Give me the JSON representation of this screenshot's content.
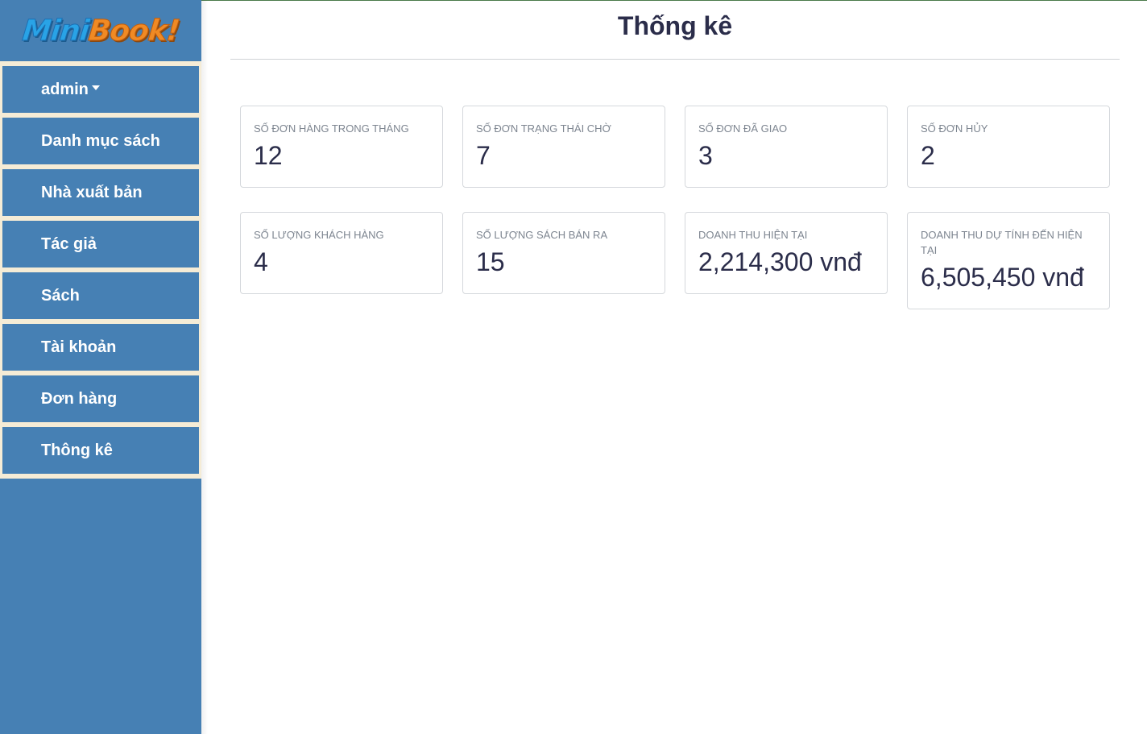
{
  "logo": {
    "part1": "Mini",
    "part2": "Book!"
  },
  "sidebar": {
    "user": "admin",
    "items": [
      {
        "label": "Danh mục sách"
      },
      {
        "label": "Nhà xuất bản"
      },
      {
        "label": "Tác giả"
      },
      {
        "label": "Sách"
      },
      {
        "label": "Tài khoản"
      },
      {
        "label": "Đơn hàng"
      },
      {
        "label": "Thông kê"
      }
    ]
  },
  "main": {
    "title": "Thống kê",
    "stats": [
      {
        "label": "Số đơn hàng trong tháng",
        "value": "12"
      },
      {
        "label": "Số đơn trạng thái chờ",
        "value": "7"
      },
      {
        "label": "Số đơn đã giao",
        "value": "3"
      },
      {
        "label": "Số đơn hủy",
        "value": "2"
      },
      {
        "label": "Số lượng khách hàng",
        "value": "4"
      },
      {
        "label": "Số lượng sách bán ra",
        "value": "15"
      },
      {
        "label": "Doanh thu hiện tại",
        "value": "2,214,300 vnđ"
      },
      {
        "label": "Doanh thu dự tính đến hiện tại",
        "value": "6,505,450 vnđ"
      }
    ]
  },
  "colors": {
    "sidebar": "#4680b4",
    "menu_gap": "#f5ecd6",
    "text_dark": "#2b2d4a",
    "label_gray": "#7d8590"
  }
}
